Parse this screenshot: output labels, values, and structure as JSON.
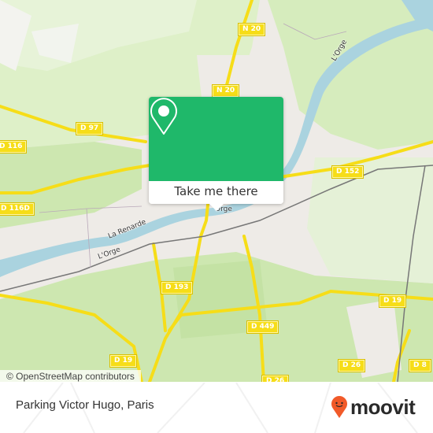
{
  "map": {
    "attribution": "© OpenStreetMap contributors",
    "road_shields": [
      {
        "id": "n20-top",
        "label": "N 20"
      },
      {
        "id": "n20-mid",
        "label": "N 20"
      },
      {
        "id": "d97",
        "label": "D 97"
      },
      {
        "id": "d116",
        "label": "D 116"
      },
      {
        "id": "d116d",
        "label": "D 116D"
      },
      {
        "id": "d152",
        "label": "D 152"
      },
      {
        "id": "d193",
        "label": "D 193"
      },
      {
        "id": "d449",
        "label": "D 449"
      },
      {
        "id": "d19-west",
        "label": "D 19"
      },
      {
        "id": "d19-east",
        "label": "D 19"
      },
      {
        "id": "d26-mid",
        "label": "D 26"
      },
      {
        "id": "d26-east",
        "label": "D 26"
      },
      {
        "id": "d8",
        "label": "D 8"
      }
    ],
    "water_labels": [
      {
        "id": "la-renarde",
        "label": "La Renarde"
      },
      {
        "id": "lorge-west",
        "label": "L'Orge"
      },
      {
        "id": "lorge-north",
        "label": "L'Orge"
      },
      {
        "id": "lorge-center",
        "label": "Orge"
      }
    ],
    "colors": {
      "land": "#eeebe7",
      "green": "#cde7b0",
      "light_green": "#def0c8",
      "water": "#aad3df",
      "road": "#f6dd18",
      "rail": "#777777"
    }
  },
  "popup": {
    "icon": "location-pin-icon",
    "button_label": "Take me there",
    "color": "#1fb86a"
  },
  "footer": {
    "place_name": "Parking Victor Hugo, Paris",
    "brand": "moovit",
    "brand_color": "#f15a29"
  }
}
